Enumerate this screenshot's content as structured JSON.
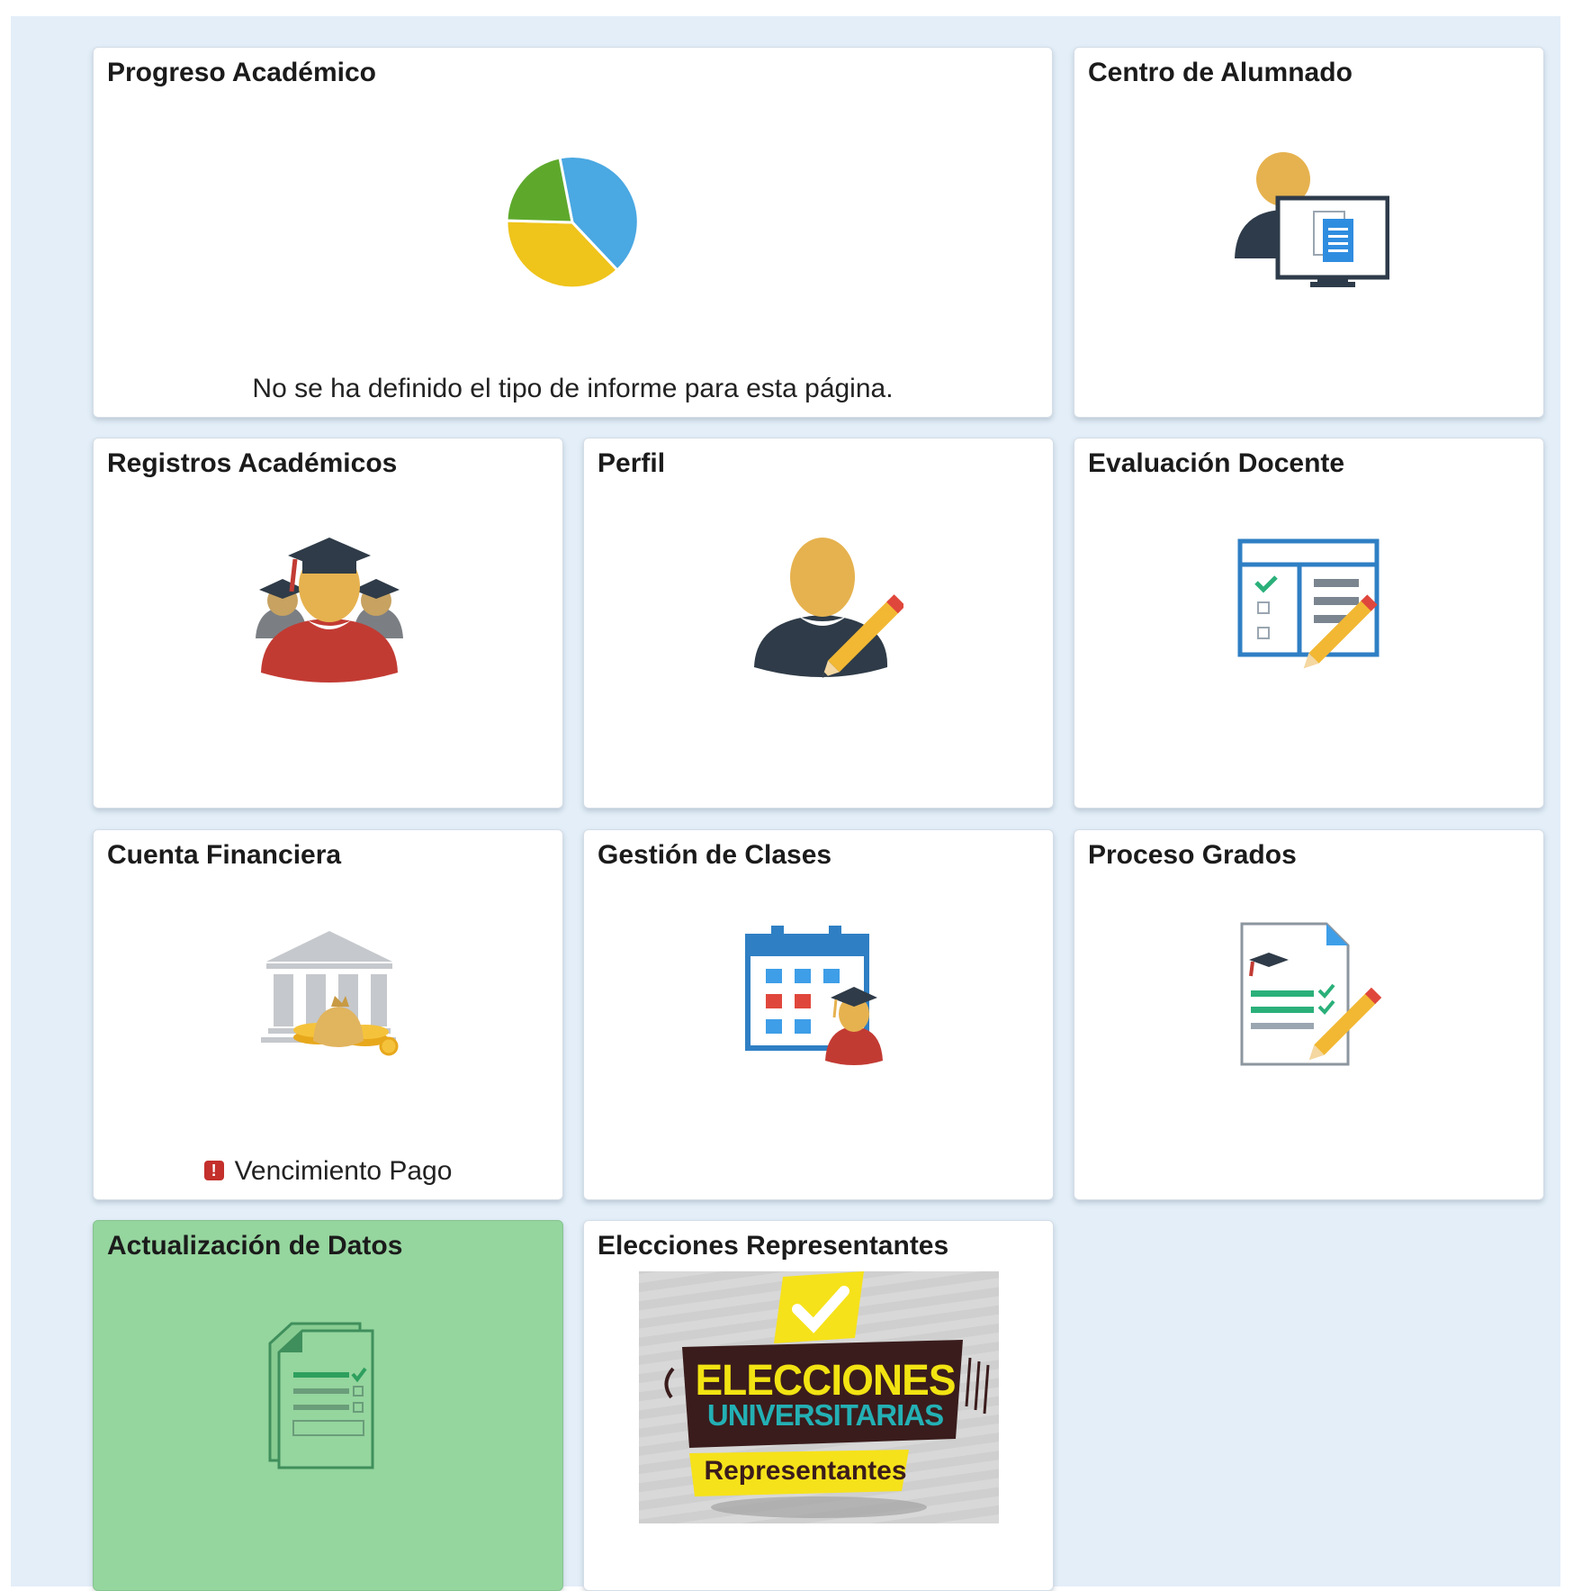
{
  "tiles": [
    {
      "title": "Progreso Académico",
      "footer": "No se ha definido el tipo de informe para esta página.",
      "icon": "pie-chart-icon"
    },
    {
      "title": "Centro de Alumnado",
      "icon": "student-center-icon"
    },
    {
      "title": "Registros Académicos",
      "icon": "graduates-icon"
    },
    {
      "title": "Perfil",
      "icon": "profile-edit-icon"
    },
    {
      "title": "Evaluación Docente",
      "icon": "evaluation-form-icon"
    },
    {
      "title": "Cuenta Financiera",
      "footer": "Vencimiento Pago",
      "footer_alert_symbol": "!",
      "icon": "bank-icon"
    },
    {
      "title": "Gestión de Clases",
      "icon": "class-calendar-icon"
    },
    {
      "title": "Proceso Grados",
      "icon": "graduation-document-icon"
    },
    {
      "title": "Actualización de Datos",
      "icon": "data-update-icon",
      "highlight_color": "#95d59e"
    },
    {
      "title": "Elecciones Representantes",
      "icon": "elections-banner-image"
    }
  ],
  "banner": {
    "line1": "ELECCIONES",
    "line2": "UNIVERSITARIAS",
    "line3": "Representantes"
  },
  "colors": {
    "background": "#e3eef8",
    "tile": "#ffffff",
    "alert": "#c4302b"
  }
}
